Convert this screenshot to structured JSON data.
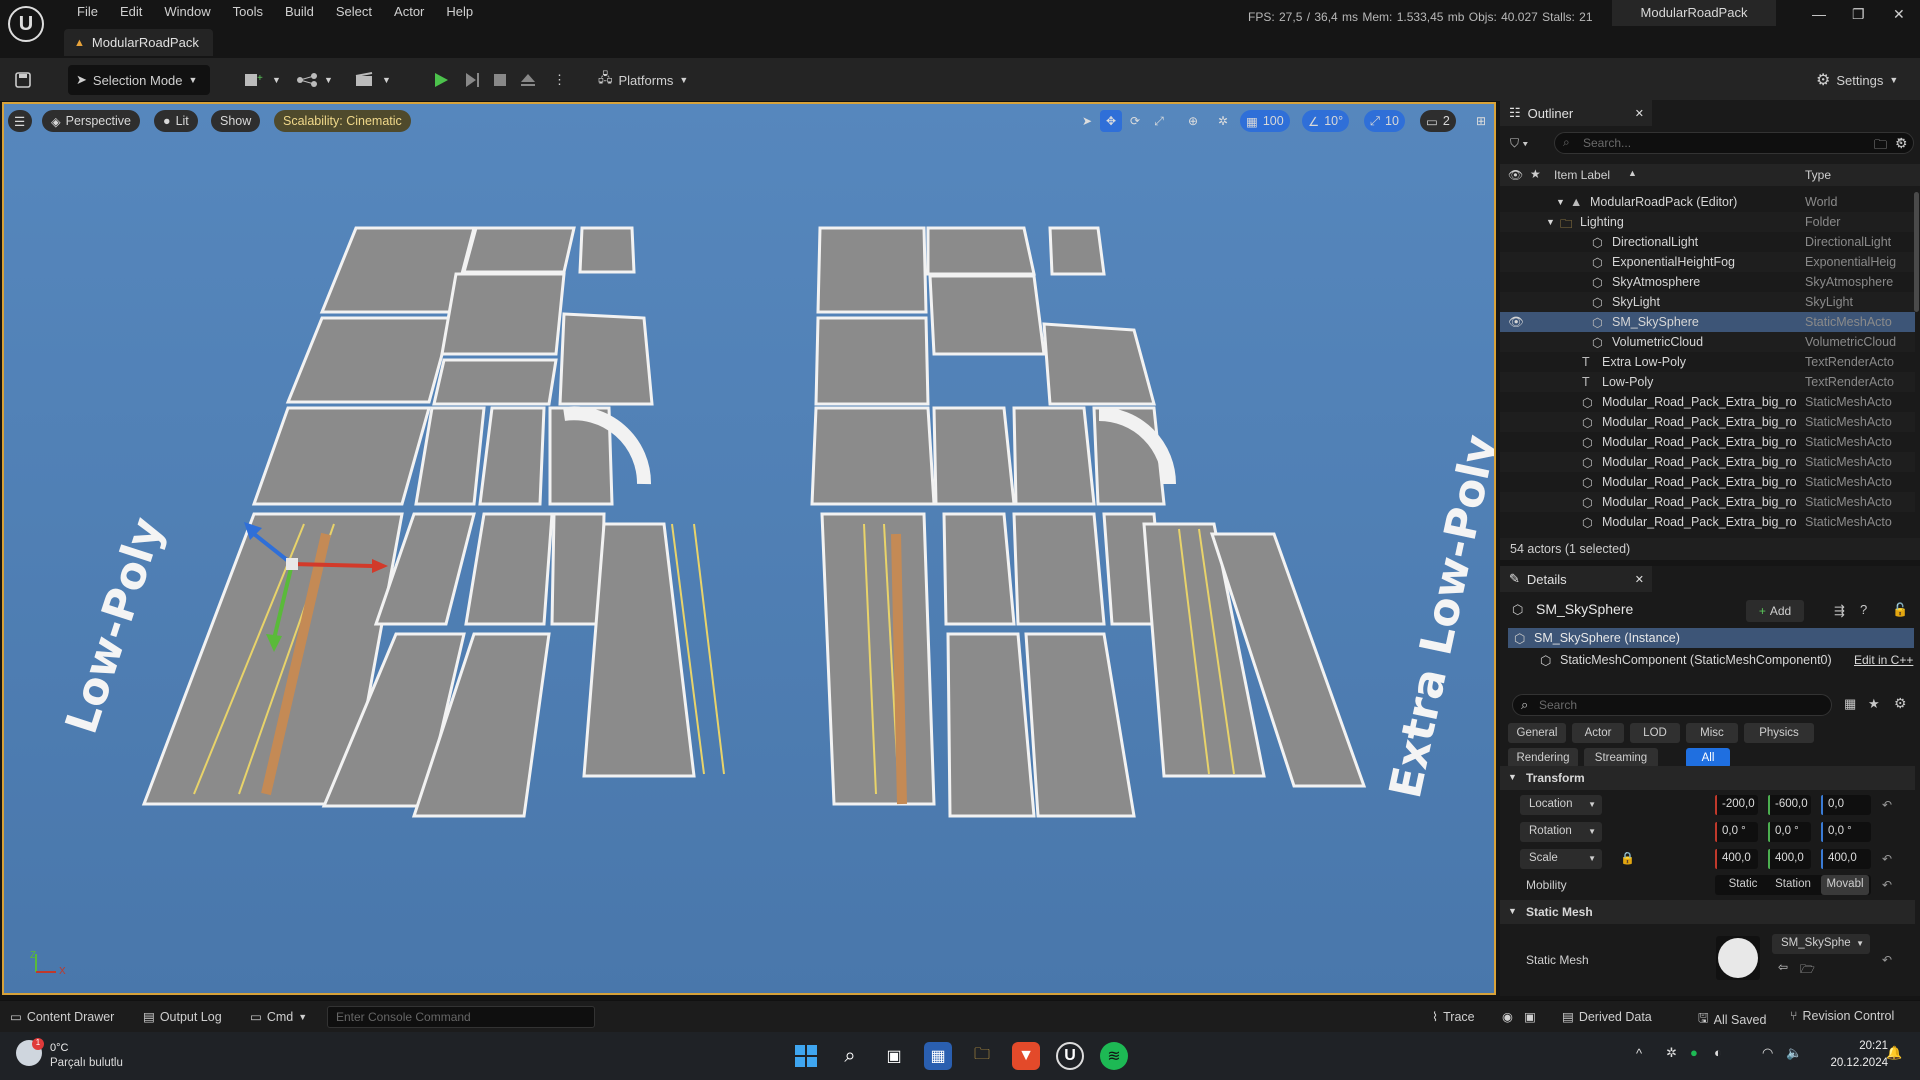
{
  "titlebar": {
    "menu": [
      "File",
      "Edit",
      "Window",
      "Tools",
      "Build",
      "Select",
      "Actor",
      "Help"
    ],
    "doc_tab": "ModularRoadPack",
    "stats": "FPS: 27,5 / 36,4 ms  Mem: 1.533,45 mb  Objs: 40.027  Stalls: 21",
    "project_name": "ModularRoadPack"
  },
  "toolbar": {
    "selection_mode": "Selection Mode",
    "platforms": "Platforms",
    "settings": "Settings"
  },
  "viewport": {
    "perspective": "Perspective",
    "lit": "Lit",
    "show": "Show",
    "scalability": "Scalability: Cinematic",
    "grid_snap": "100",
    "rot_snap": "10°",
    "scale_snap": "10",
    "cam_speed": "2",
    "scene_label_left": "Low-Poly",
    "scene_label_right": "Extra Low-Poly",
    "axis_z": "Z",
    "axis_x": "X",
    "colors": {
      "sky": "#4f7fb3",
      "road": "#8b8b8b",
      "line": "#e8d36a",
      "curb": "#f2f2f2"
    }
  },
  "outliner": {
    "tab": "Outliner",
    "search_placeholder": "Search...",
    "col_label": "Item Label",
    "col_type": "Type",
    "rows": [
      {
        "label": "ModularRoadPack (Editor)",
        "type": "World"
      },
      {
        "label": "Lighting",
        "type": "Folder"
      },
      {
        "label": "DirectionalLight",
        "type": "DirectionalLight"
      },
      {
        "label": "ExponentialHeightFog",
        "type": "ExponentialHeig"
      },
      {
        "label": "SkyAtmosphere",
        "type": "SkyAtmosphere"
      },
      {
        "label": "SkyLight",
        "type": "SkyLight"
      },
      {
        "label": "SM_SkySphere",
        "type": "StaticMeshActo"
      },
      {
        "label": "VolumetricCloud",
        "type": "VolumetricCloud"
      },
      {
        "label": "Extra Low-Poly",
        "type": "TextRenderActo"
      },
      {
        "label": "Low-Poly",
        "type": "TextRenderActo"
      },
      {
        "label": "Modular_Road_Pack_Extra_big_ro",
        "type": "StaticMeshActo"
      },
      {
        "label": "Modular_Road_Pack_Extra_big_ro",
        "type": "StaticMeshActo"
      },
      {
        "label": "Modular_Road_Pack_Extra_big_ro",
        "type": "StaticMeshActo"
      },
      {
        "label": "Modular_Road_Pack_Extra_big_ro",
        "type": "StaticMeshActo"
      },
      {
        "label": "Modular_Road_Pack_Extra_big_ro",
        "type": "StaticMeshActo"
      },
      {
        "label": "Modular_Road_Pack_Extra_big_ro",
        "type": "StaticMeshActo"
      },
      {
        "label": "Modular_Road_Pack_Extra_big_ro",
        "type": "StaticMeshActo"
      }
    ],
    "footer": "54 actors (1 selected)"
  },
  "details": {
    "tab": "Details",
    "actor_name": "SM_SkySphere",
    "add_label": "Add",
    "instance_label": "SM_SkySphere (Instance)",
    "component_label": "StaticMeshComponent (StaticMeshComponent0)",
    "edit_cpp": "Edit in C++",
    "search_placeholder": "Search",
    "categories_row1": [
      "General",
      "Actor",
      "LOD",
      "Misc",
      "Physics"
    ],
    "categories_row2": [
      "Rendering",
      "Streaming",
      "All"
    ],
    "transform_header": "Transform",
    "location_label": "Location",
    "location": [
      "-200,0",
      "-600,0",
      "0,0"
    ],
    "rotation_label": "Rotation",
    "rotation": [
      "0,0 °",
      "0,0 °",
      "0,0 °"
    ],
    "scale_label": "Scale",
    "scale": [
      "400,0",
      "400,0",
      "400,0"
    ],
    "mobility_label": "Mobility",
    "mobility_options": [
      "Static",
      "Station",
      "Movabl"
    ],
    "static_mesh_header": "Static Mesh",
    "static_mesh_label": "Static Mesh",
    "static_mesh_value": "SM_SkySphe"
  },
  "statusbar": {
    "content_drawer": "Content Drawer",
    "output_log": "Output Log",
    "cmd": "Cmd",
    "console_placeholder": "Enter Console Command",
    "trace": "Trace",
    "derived_data": "Derived Data",
    "all_saved": "All Saved",
    "revision_control": "Revision Control"
  },
  "taskbar": {
    "weather_temp": "0°C",
    "weather_desc": "Parçalı bulutlu",
    "time": "20:21",
    "date": "20.12.2024"
  }
}
